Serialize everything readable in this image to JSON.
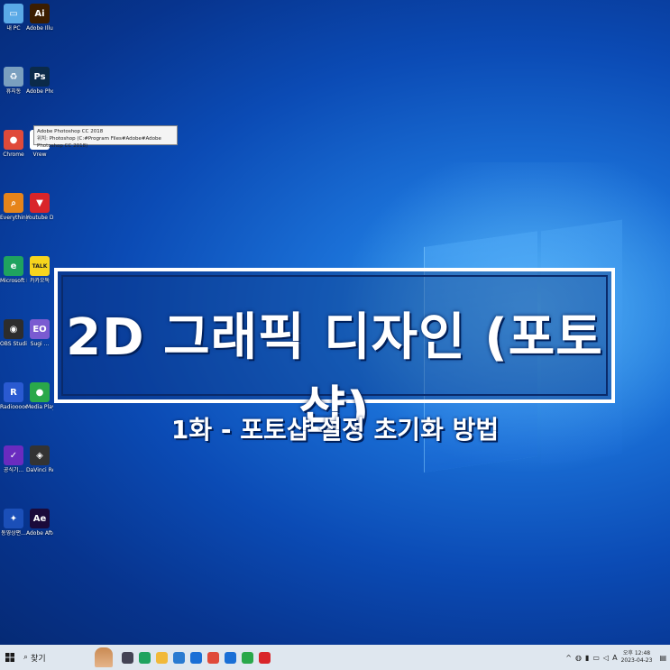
{
  "desktop_icons": [
    {
      "name": "icon-this-pc",
      "label": "내 PC",
      "glyph": "▭",
      "color": "#5aa9e6"
    },
    {
      "name": "icon-illustrator",
      "label": "Adobe Illustrator...",
      "glyph": "Ai",
      "color": "#3b1d00"
    },
    {
      "name": "icon-recycle-bin",
      "label": "휴지통",
      "glyph": "♻",
      "color": "#7a9fbf"
    },
    {
      "name": "icon-photoshop",
      "label": "Adobe Photosh...",
      "glyph": "Ps",
      "color": "#0b2a49"
    },
    {
      "name": "icon-chrome",
      "label": "Chrome",
      "glyph": "●",
      "color": "#e04a3a"
    },
    {
      "name": "icon-vrew",
      "label": "Vrew",
      "glyph": "V",
      "color": "#ffffff"
    },
    {
      "name": "icon-everything",
      "label": "Everything",
      "glyph": "⌕",
      "color": "#e6841a"
    },
    {
      "name": "icon-youtube-downloader",
      "label": "Youtube Downloa...",
      "glyph": "▼",
      "color": "#d9252a"
    },
    {
      "name": "icon-edge",
      "label": "Microsoft Edge",
      "glyph": "e",
      "color": "#1fa35f"
    },
    {
      "name": "icon-kakaotalk",
      "label": "카카오톡",
      "glyph": "TALK",
      "color": "#f7d51d"
    },
    {
      "name": "icon-obs",
      "label": "OBS Studio",
      "glyph": "◉",
      "color": "#2d2d2d"
    },
    {
      "name": "icon-sugi",
      "label": "Sugi ...",
      "glyph": "EO",
      "color": "#7a5bd1"
    },
    {
      "name": "icon-radiooooo",
      "label": "Radiooooo",
      "glyph": "R",
      "color": "#2a5ad1"
    },
    {
      "name": "icon-media-player",
      "label": "Media Player",
      "glyph": "●",
      "color": "#2aa84a"
    },
    {
      "name": "icon-app-purple",
      "label": "공식기...",
      "glyph": "✓",
      "color": "#6a2bbf"
    },
    {
      "name": "icon-davinci",
      "label": "DaVinci Resolve",
      "glyph": "◈",
      "color": "#333333"
    },
    {
      "name": "icon-app-runner",
      "label": "동영상편...",
      "glyph": "✦",
      "color": "#1b4fb8"
    },
    {
      "name": "icon-after-effects",
      "label": "Adobe After Effects CC...",
      "glyph": "Ae",
      "color": "#1b0a3a"
    }
  ],
  "tooltip": {
    "line1": "Adobe Photoshop CC 2018",
    "line2": "위치: Photoshop (C:#Program Files#Adobe#Adobe Photoshop CC 2018)"
  },
  "overlay": {
    "title": "2D 그래픽 디자인 (포토샵)",
    "subtitle": "1화 - 포토샵 설정 초기화 방법"
  },
  "taskbar": {
    "search_placeholder": "찾기",
    "apps": [
      {
        "name": "taskbar-task-view",
        "color": "#445"
      },
      {
        "name": "taskbar-edge",
        "color": "#1fa35f"
      },
      {
        "name": "taskbar-explorer",
        "color": "#f1b93a"
      },
      {
        "name": "taskbar-store",
        "color": "#2a7bd1"
      },
      {
        "name": "taskbar-mail",
        "color": "#1a6fd6"
      },
      {
        "name": "taskbar-chrome",
        "color": "#e04a3a"
      },
      {
        "name": "taskbar-app-blue",
        "color": "#1a6fd6"
      },
      {
        "name": "taskbar-app-green",
        "color": "#2aa84a"
      },
      {
        "name": "taskbar-app-red",
        "color": "#d9252a"
      }
    ],
    "tray": {
      "ime": "A",
      "time": "오후 12:48",
      "date": "2023-04-23"
    }
  }
}
